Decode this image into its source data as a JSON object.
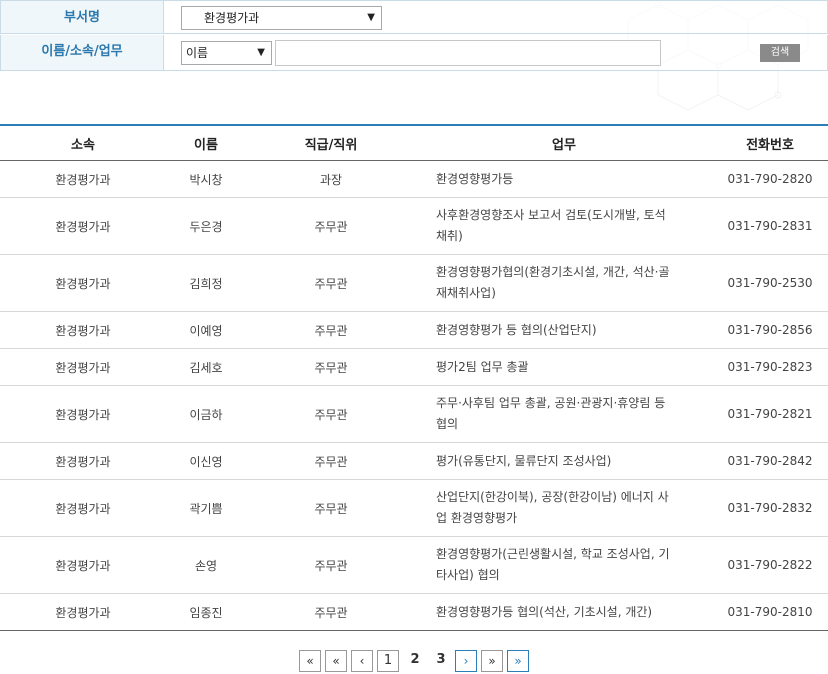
{
  "search": {
    "dept_label": "부서명",
    "dept_selected": "환경평가과",
    "query_label": "이름/소속/업무",
    "query_type_selected": "이름",
    "query_value": "",
    "search_button": "검색"
  },
  "table": {
    "headers": [
      "소속",
      "이름",
      "직급/직위",
      "업무",
      "전화번호"
    ],
    "rows": [
      {
        "dept": "환경평가과",
        "name": "박시창",
        "rank": "과장",
        "duty_1": "환경영향평가등",
        "duty_2": "",
        "phone": "031-790-2820"
      },
      {
        "dept": "환경평가과",
        "name": "두은경",
        "rank": "주무관",
        "duty_1": "사후환경영향조사 보고서 검토(도시개발, 토석",
        "duty_2": "채취)",
        "phone": "031-790-2831"
      },
      {
        "dept": "환경평가과",
        "name": "김희정",
        "rank": "주무관",
        "duty_1": "환경영향평가협의(환경기초시설, 개간, 석산·골",
        "duty_2": "재채취사업)",
        "phone": "031-790-2530"
      },
      {
        "dept": "환경평가과",
        "name": "이예영",
        "rank": "주무관",
        "duty_1": "환경영향평가 등 협의(산업단지)",
        "duty_2": "",
        "phone": "031-790-2856"
      },
      {
        "dept": "환경평가과",
        "name": "김세호",
        "rank": "주무관",
        "duty_1": "평가2팀 업무 총괄",
        "duty_2": "",
        "phone": "031-790-2823"
      },
      {
        "dept": "환경평가과",
        "name": "이금하",
        "rank": "주무관",
        "duty_1": "주무·사후팀 업무 총괄, 공원·관광지·휴양림 등",
        "duty_2": "협의",
        "phone": "031-790-2821"
      },
      {
        "dept": "환경평가과",
        "name": "이신영",
        "rank": "주무관",
        "duty_1": "평가(유통단지, 물류단지 조성사업)",
        "duty_2": "",
        "phone": "031-790-2842"
      },
      {
        "dept": "환경평가과",
        "name": "곽기쁨",
        "rank": "주무관",
        "duty_1": "산업단지(한강이북), 공장(한강이남) 에너지 사",
        "duty_2": "업 환경영향평가",
        "phone": "031-790-2832"
      },
      {
        "dept": "환경평가과",
        "name": "손영",
        "rank": "주무관",
        "duty_1": "환경영향평가(근린생활시설, 학교 조성사업, 기",
        "duty_2": "타사업) 협의",
        "phone": "031-790-2822"
      },
      {
        "dept": "환경평가과",
        "name": "임종진",
        "rank": "주무관",
        "duty_1": "환경영향평가등 협의(석산, 기초시설, 개간)",
        "duty_2": "",
        "phone": "031-790-2810"
      }
    ]
  },
  "pagination": {
    "first": "«",
    "prev_block": "«",
    "prev": "‹",
    "pages": [
      "1",
      "2",
      "3"
    ],
    "current": "1",
    "next": "›",
    "next_block": "»",
    "last": "»"
  }
}
